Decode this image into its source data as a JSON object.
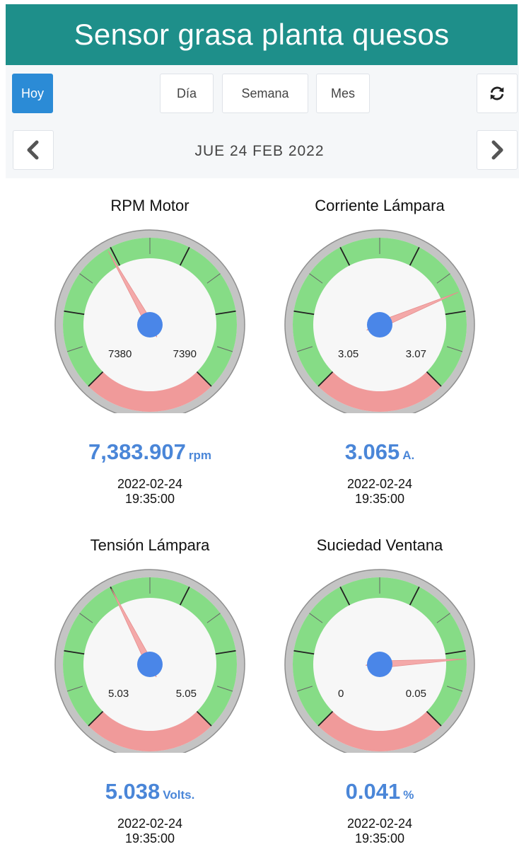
{
  "header": {
    "title": "Sensor grasa planta quesos"
  },
  "toolbar": {
    "buttons": {
      "today": "Hoy",
      "day": "Día",
      "week": "Semana",
      "month": "Mes"
    },
    "refresh_icon": "refresh-icon",
    "prev_icon": "chevron-left-icon",
    "next_icon": "chevron-right-icon",
    "date": "JUE 24 FEB 2022"
  },
  "colors": {
    "header_bg": "#1e8f8a",
    "active_button": "#2b8bd6",
    "value_text": "#4a86d8",
    "gauge_green": "#86dc86",
    "gauge_red": "#f09a9a",
    "needle": "#f4a9a9",
    "hub": "#4a86e8"
  },
  "gauges": [
    {
      "title": "RPM Motor",
      "min_label": "7380",
      "max_label": "7390",
      "min": 7380,
      "max": 7390,
      "value": 7383.907,
      "value_text": "7,383.907",
      "unit": "rpm",
      "date": "2022-02-24",
      "time": "19:35:00"
    },
    {
      "title": "Corriente Lámpara",
      "min_label": "3.05",
      "max_label": "3.07",
      "min": 3.05,
      "max": 3.07,
      "value": 3.065,
      "value_text": "3.065",
      "unit": "A.",
      "date": "2022-02-24",
      "time": "19:35:00"
    },
    {
      "title": "Tensión Lámpara",
      "min_label": "5.03",
      "max_label": "5.05",
      "min": 5.03,
      "max": 5.05,
      "value": 5.038,
      "value_text": "5.038",
      "unit": "Volts.",
      "date": "2022-02-24",
      "time": "19:35:00"
    },
    {
      "title": "Suciedad Ventana",
      "min_label": "0",
      "max_label": "0.05",
      "min": 0,
      "max": 0.05,
      "value": 0.041,
      "value_text": "0.041",
      "unit": "%",
      "date": "2022-02-24",
      "time": "19:35:00"
    }
  ]
}
